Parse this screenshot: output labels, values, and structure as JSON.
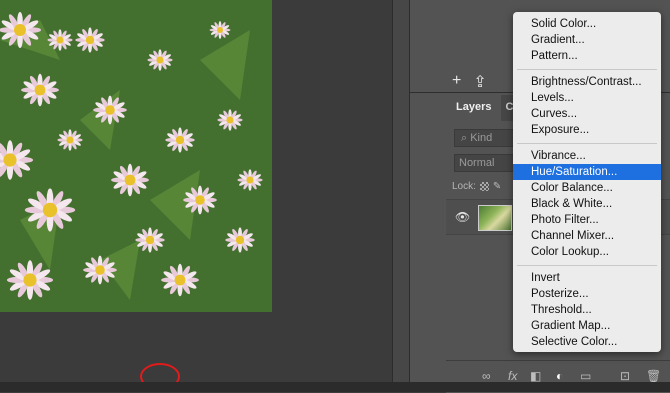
{
  "layers_panel": {
    "tab_layers": "Layers",
    "tab_next_partial": "C",
    "kind_placeholder": "Kind",
    "blend_mode": "Normal",
    "lock_label": "Lock:"
  },
  "adjustments_menu": {
    "items": [
      "Solid Color...",
      "Gradient...",
      "Pattern...",
      "Brightness/Contrast...",
      "Levels...",
      "Curves...",
      "Exposure...",
      "Vibrance...",
      "Hue/Saturation...",
      "Color Balance...",
      "Black & White...",
      "Photo Filter...",
      "Channel Mixer...",
      "Color Lookup...",
      "Invert",
      "Posterize...",
      "Threshold...",
      "Gradient Map...",
      "Selective Color..."
    ],
    "selected": "Hue/Saturation...",
    "highlight_color": "#1e6fe0"
  },
  "bottom_bar": {
    "fx_label": "fx"
  },
  "colors": {
    "annotation_circle": "#e11b1b"
  }
}
